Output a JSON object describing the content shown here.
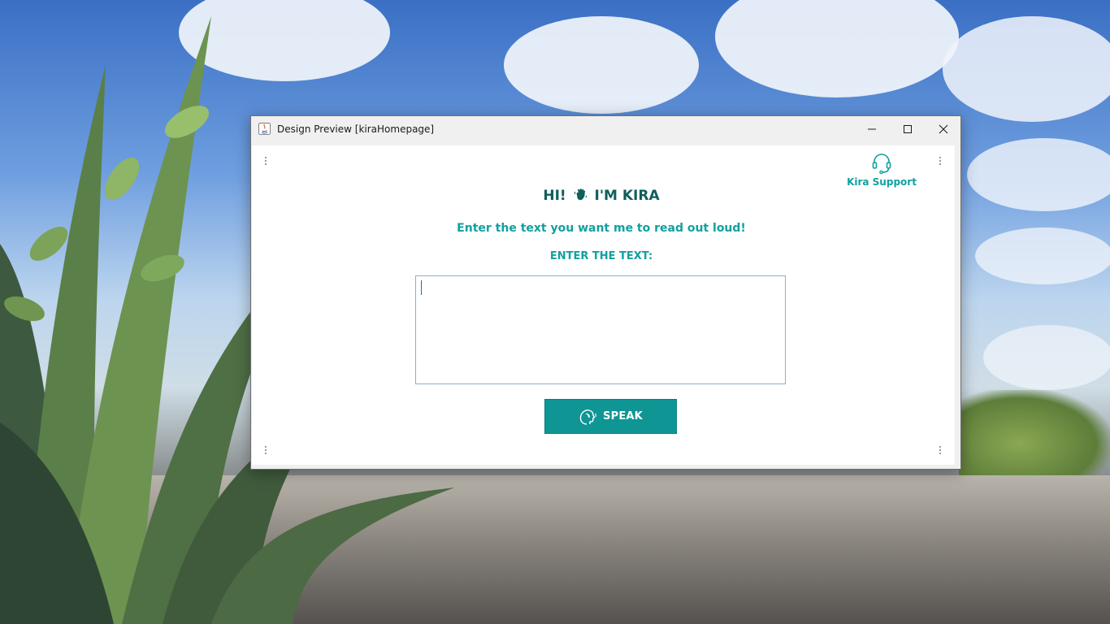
{
  "window": {
    "title": "Design Preview [kiraHomepage]",
    "controls": {
      "minimize": "minimize",
      "maximize": "maximize",
      "close": "close"
    }
  },
  "support": {
    "label": "Kira Support",
    "icon": "headset-icon"
  },
  "greeting": {
    "prefix": "HI!",
    "icon": "waving-hand-icon",
    "suffix": "I'M KIRA"
  },
  "subtitle": "Enter the text you want me to read out loud!",
  "input": {
    "label": "ENTER THE TEXT:",
    "value": "",
    "placeholder": ""
  },
  "speak_button": {
    "label": "SPEAK",
    "icon": "speaking-head-icon"
  },
  "colors": {
    "accent": "#109595",
    "heading": "#0e5f5a",
    "label": "#11a0a0",
    "input_border": "#8fb0cf"
  }
}
